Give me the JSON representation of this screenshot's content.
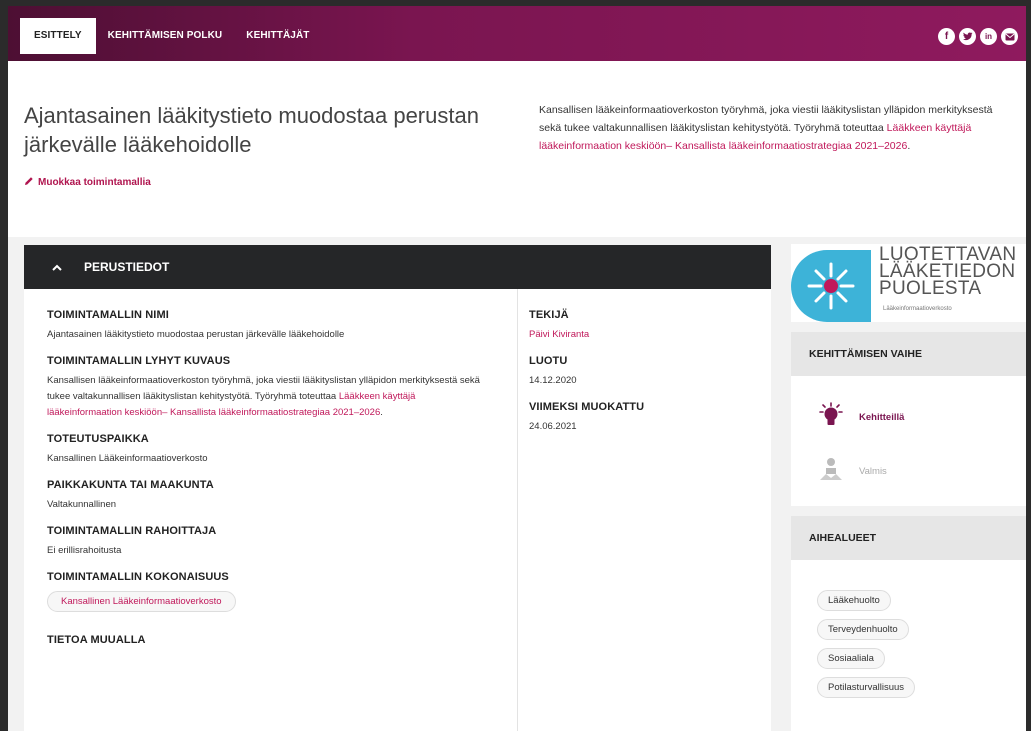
{
  "nav": {
    "tabs": [
      {
        "label": "ESITTELY",
        "active": true
      },
      {
        "label": "KEHITTÄMISEN POLKU",
        "active": false
      },
      {
        "label": "KEHITTÄJÄT",
        "active": false
      }
    ],
    "social": [
      "facebook-icon",
      "twitter-icon",
      "linkedin-icon",
      "email-icon"
    ]
  },
  "hero": {
    "title": "Ajantasainen lääkitystieto muodostaa perustan järkevälle lääkehoidolle",
    "edit_label": "Muokkaa toimintamallia",
    "description": "Kansallisen lääkeinformaatioverkoston työryhmä, joka viestii lääkityslistan ylläpidon merkityksestä sekä tukee valtakunnallisen lääkityslistan kehitystyötä. Työryhmä toteuttaa ",
    "description_link": "Lääkkeen käyttäjä lääkeinformaation keskiöön– Kansallista lääkeinformaatiostrategiaa 2021–2026",
    "description_end": "."
  },
  "panel": {
    "title": "PERUSTIEDOT",
    "fields": {
      "name_label": "TOIMINTAMALLIN NIMI",
      "name_value": "Ajantasainen lääkitystieto muodostaa perustan järkevälle lääkehoidolle",
      "short_label": "TOIMINTAMALLIN LYHYT KUVAUS",
      "short_value": "Kansallisen lääkeinformaatioverkoston työryhmä, joka viestii lääkityslistan ylläpidon merkityksestä sekä tukee valtakunnallisen lääkityslistan kehitystyötä. Työryhmä toteuttaa ",
      "short_link": "Lääkkeen käyttäjä lääkeinformaation keskiöön– Kansallista lääkeinformaatiostrategiaa 2021–2026",
      "short_end": ".",
      "place_label": "TOTEUTUSPAIKKA",
      "place_value": "Kansallinen Lääkeinformaatioverkosto",
      "region_label": "PAIKKAKUNTA TAI MAAKUNTA",
      "region_value": "Valtakunnallinen",
      "funder_label": "TOIMINTAMALLIN RAHOITTAJA",
      "funder_value": "Ei erillisrahoitusta",
      "entity_label": "TOIMINTAMALLIN KOKONAISUUS",
      "entity_chip": "Kansallinen Lääkeinformaatioverkosto",
      "elsewhere_label": "TIETOA MUUALLA",
      "author_label": "TEKIJÄ",
      "author_value": "Päivi Kiviranta",
      "created_label": "LUOTU",
      "created_value": "14.12.2020",
      "modified_label": "VIIMEKSI MUOKATTU",
      "modified_value": "24.06.2021"
    }
  },
  "logo": {
    "line1": "LUOTETTAVAN",
    "line2": "LÄÄKETIEDON",
    "line3": "PUOLESTA",
    "sub": "Lääkeinformaatioverkosto"
  },
  "stage": {
    "title": "KEHITTÄMISEN VAIHE",
    "active": "Kehitteillä",
    "done": "Valmis"
  },
  "topics": {
    "title": "AIHEALUEET",
    "tags": [
      "Lääkehuolto",
      "Terveydenhuolto",
      "Sosiaaliala",
      "Potilasturvallisuus"
    ]
  },
  "colors": {
    "brand": "#7a1550",
    "link": "#c0185a",
    "panel_header": "#252628",
    "logo_blue": "#3db3d8"
  }
}
